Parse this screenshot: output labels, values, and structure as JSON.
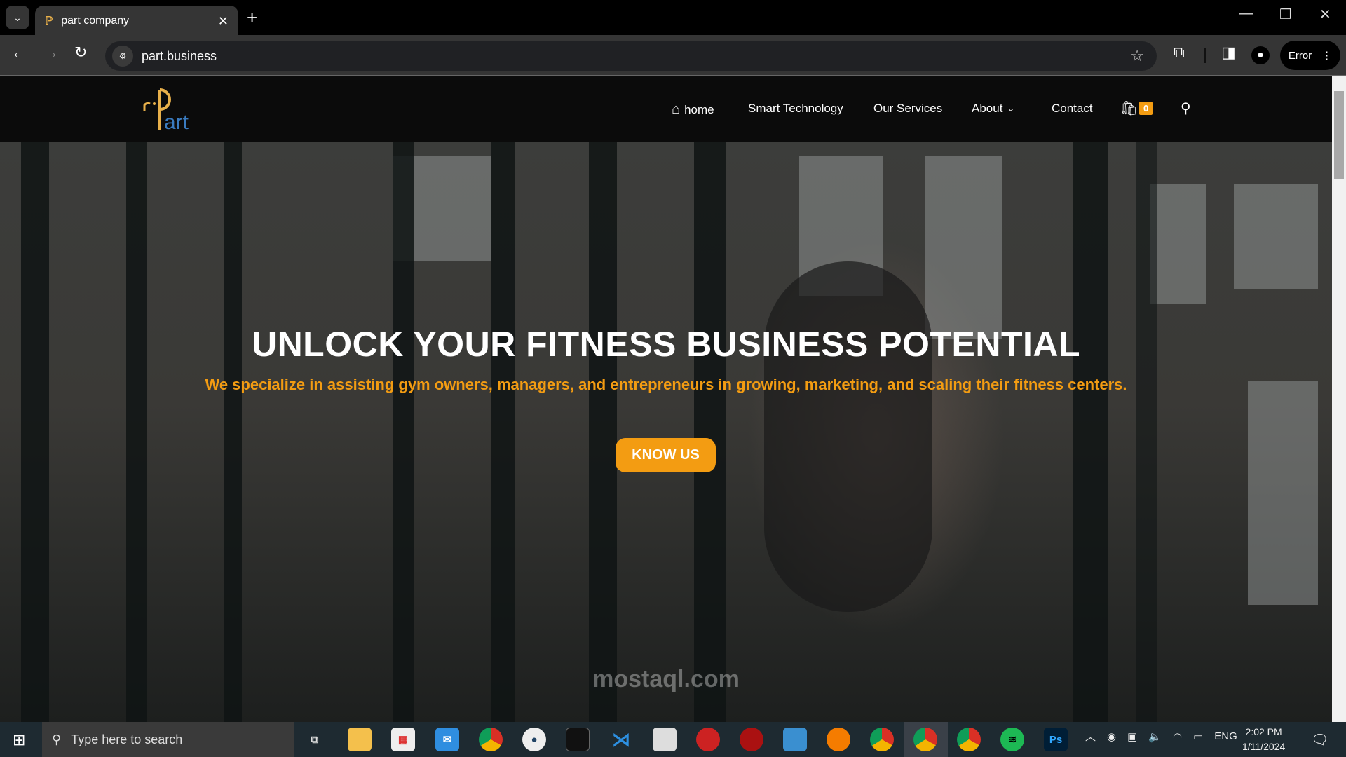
{
  "browser": {
    "tab_title": "part company",
    "url": "part.business",
    "profile_button": "Error",
    "icons": [
      "tab-list-icon",
      "close-icon",
      "new-tab-icon",
      "minimize-icon",
      "restore-icon",
      "window-close-icon",
      "back-icon",
      "forward-icon",
      "reload-icon",
      "site-info-icon",
      "star-icon",
      "extensions-icon",
      "side-panel-icon",
      "profile-icon",
      "menu-icon"
    ]
  },
  "site": {
    "logo_text": "Part",
    "nav": [
      {
        "label": "home"
      },
      {
        "label": "Smart Technology"
      },
      {
        "label": "Our Services"
      },
      {
        "label": "About"
      },
      {
        "label": "Contact"
      }
    ],
    "cart_count": "0"
  },
  "hero": {
    "title": "UNLOCK YOUR FITNESS BUSINESS POTENTIAL",
    "subtitle": "We specialize in assisting gym owners, managers, and entrepreneurs in growing, marketing, and scaling their fitness centers.",
    "button": "KNOW US",
    "watermark": "mostaql.com"
  },
  "colors": {
    "accent": "#f39c12",
    "header_bg": "#0b0b0b"
  },
  "taskbar": {
    "search_placeholder": "Type here to search",
    "language": "ENG",
    "time": "2:02 PM",
    "date": "1/11/2024",
    "apps": [
      "task-view",
      "file-explorer",
      "microsoft-store",
      "mail",
      "chrome",
      "app",
      "terminal",
      "vscode",
      "app",
      "app",
      "app",
      "firefox",
      "chrome",
      "chrome-profile",
      "chrome-profile-2",
      "spotify",
      "photoshop"
    ]
  }
}
